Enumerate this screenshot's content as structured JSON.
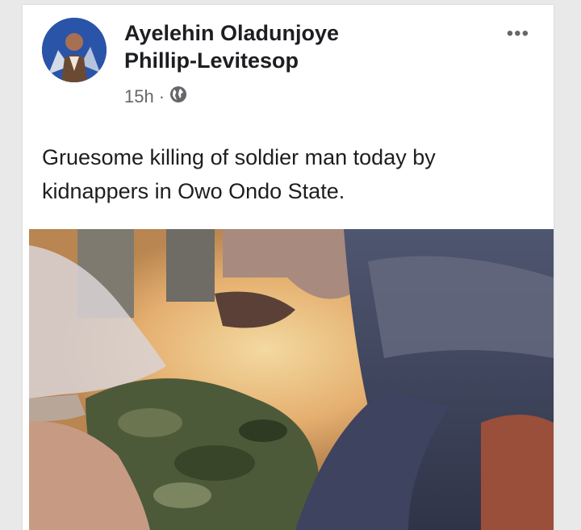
{
  "post": {
    "author_line1": "Ayelehin Oladunjoye",
    "author_line2": "Phillip-Levitesop",
    "time": "15h",
    "separator": "·",
    "privacy_icon": "globe-icon",
    "more_icon": "more-options-icon",
    "more_label": "•••",
    "text": "Gruesome killing of soldier man today by kidnappers in Owo Ondo State."
  },
  "colors": {
    "background": "#e9e9ea",
    "card": "#ffffff",
    "name_text": "#1c1e21",
    "meta_text": "#65676b"
  }
}
